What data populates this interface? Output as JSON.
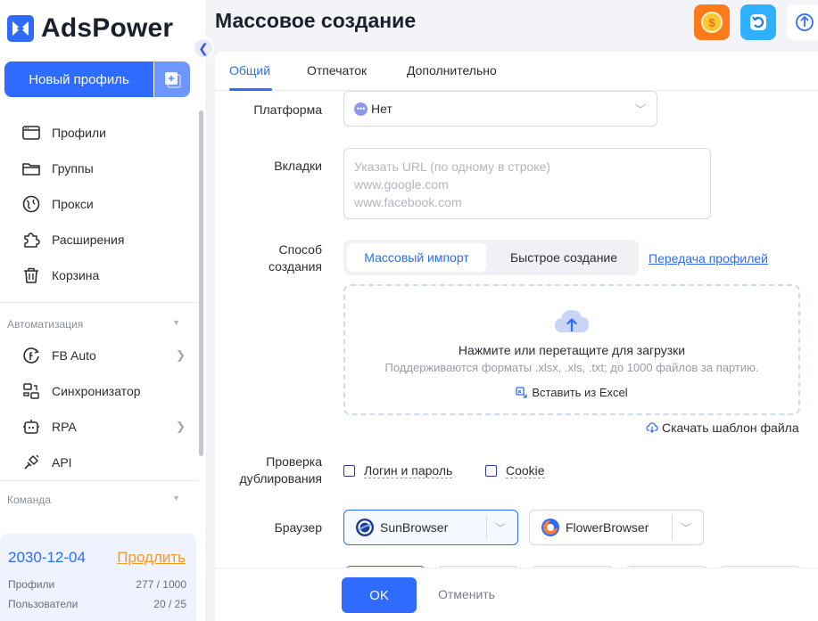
{
  "app": {
    "brand": "AdsPower",
    "page_title": "Массовое создание"
  },
  "sidebar": {
    "new_profile_label": "Новый профиль",
    "items": [
      {
        "label": "Профили",
        "icon": "browser-window-icon"
      },
      {
        "label": "Группы",
        "icon": "folder-icon"
      },
      {
        "label": "Прокси",
        "icon": "proxy-globe-icon"
      },
      {
        "label": "Расширения",
        "icon": "puzzle-icon"
      },
      {
        "label": "Корзина",
        "icon": "trash-icon"
      }
    ],
    "automation_title": "Автоматизация",
    "automation_items": [
      {
        "label": "FB Auto",
        "icon": "fb-auto-icon",
        "has_submenu": true
      },
      {
        "label": "Синхронизатор",
        "icon": "sync-icon",
        "has_submenu": false
      },
      {
        "label": "RPA",
        "icon": "robot-icon",
        "has_submenu": true
      },
      {
        "label": "API",
        "icon": "api-plug-icon",
        "has_submenu": false
      }
    ],
    "team_title": "Команда",
    "plan": {
      "expiry": "2030-12-04",
      "renew_label": "Продлить",
      "profiles_label": "Профили",
      "profiles_value": "277 / 1000",
      "users_label": "Пользователи",
      "users_value": "20 / 25"
    }
  },
  "tabs": [
    {
      "label": "Общий",
      "active": true
    },
    {
      "label": "Отпечаток",
      "active": false
    },
    {
      "label": "Дополнительно",
      "active": false
    }
  ],
  "form": {
    "platform_label": "Платформа",
    "platform_value": "Нет",
    "tabs_label": "Вкладки",
    "tabs_placeholder_lines": [
      "Указать URL (по одному в строке)",
      "www.google.com",
      "www.facebook.com"
    ],
    "method_label_line1": "Способ",
    "method_label_line2": "создания",
    "method_options": [
      "Массовый импорт",
      "Быстрое создание"
    ],
    "transfer_link": "Передача профилей",
    "upload_main": "Нажмите или перетащите для загрузки",
    "upload_sub": "Поддерживаются форматы .xlsx, .xls, .txt; до 1000 файлов за партию.",
    "paste_excel": "Вставить из Excel",
    "download_template": "Скачать шаблон файла",
    "dup_label_line1": "Проверка",
    "dup_label_line2": "дублирования",
    "dup_options": [
      "Логин и пароль",
      "Cookie"
    ],
    "browser_label": "Браузер",
    "browsers": [
      {
        "name": "SunBrowser",
        "selected": true
      },
      {
        "name": "FlowerBrowser",
        "selected": false
      }
    ]
  },
  "footer": {
    "ok": "OK",
    "cancel": "Отменить"
  },
  "colors": {
    "accent": "#2f6bff",
    "renew": "#f59a23"
  }
}
